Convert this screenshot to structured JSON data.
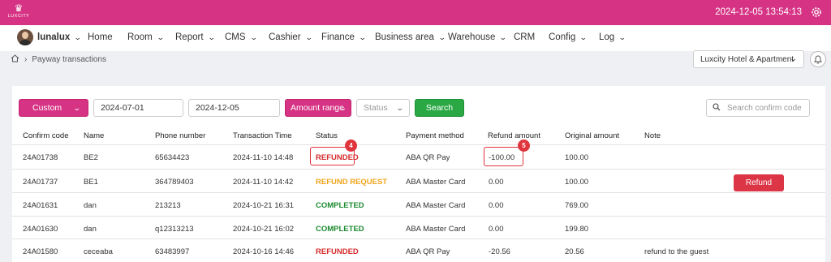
{
  "topbar": {
    "logo_text": "LUXCITY",
    "datetime": "2024-12-05 13:54:13"
  },
  "nav": {
    "user": "lunalux",
    "items": [
      {
        "label": "Home",
        "has_menu": false
      },
      {
        "label": "Room",
        "has_menu": true
      },
      {
        "label": "Report",
        "has_menu": true
      },
      {
        "label": "CMS",
        "has_menu": true
      },
      {
        "label": "Cashier",
        "has_menu": true
      },
      {
        "label": "Finance",
        "has_menu": true
      },
      {
        "label": "Business area",
        "has_menu": true
      },
      {
        "label": "Warehouse",
        "has_menu": true
      },
      {
        "label": "CRM",
        "has_menu": false
      },
      {
        "label": "Config",
        "has_menu": true
      },
      {
        "label": "Log",
        "has_menu": true
      }
    ]
  },
  "breadcrumb": {
    "page": "Payway transactions"
  },
  "hotel_select": {
    "value": "Luxcity Hotel & Apartment"
  },
  "filters": {
    "period": "Custom",
    "date_from": "2024-07-01",
    "date_to": "2024-12-05",
    "amount_range": "Amount range",
    "status_placeholder": "Status",
    "search_button": "Search",
    "search_placeholder": "Search confirm code"
  },
  "table": {
    "columns": [
      "Confirm code",
      "Name",
      "Phone number",
      "Transaction Time",
      "Status",
      "Payment method",
      "Refund amount",
      "Original amount",
      "Note"
    ],
    "rows": [
      {
        "code": "24A01738",
        "name": "BE2",
        "phone": "65634423",
        "time": "2024-11-10 14:48",
        "status": "REFUNDED",
        "method": "ABA QR Pay",
        "refund": "-100.00",
        "original": "100.00",
        "note": ""
      },
      {
        "code": "24A01737",
        "name": "BE1",
        "phone": "364789403",
        "time": "2024-11-10 14:42",
        "status": "REFUND REQUEST",
        "method": "ABA Master Card",
        "refund": "0.00",
        "original": "100.00",
        "note": ""
      },
      {
        "code": "24A01631",
        "name": "dan",
        "phone": "213213",
        "time": "2024-10-21 16:31",
        "status": "COMPLETED",
        "method": "ABA Master Card",
        "refund": "0.00",
        "original": "769.00",
        "note": ""
      },
      {
        "code": "24A01630",
        "name": "dan",
        "phone": "q12313213",
        "time": "2024-10-21 16:02",
        "status": "COMPLETED",
        "method": "ABA Master Card",
        "refund": "0.00",
        "original": "199.80",
        "note": ""
      },
      {
        "code": "24A01580",
        "name": "ceceaba",
        "phone": "63483997",
        "time": "2024-10-16 14:46",
        "status": "REFUNDED",
        "method": "ABA QR Pay",
        "refund": "-20.56",
        "original": "20.56",
        "note": "refund to the guest"
      }
    ],
    "refund_button": "Refund"
  },
  "annotations": {
    "badge_status": "4",
    "badge_refund": "5"
  },
  "colors": {
    "brand": "#d63384",
    "success": "#29a844",
    "danger": "#dc3545",
    "warning": "#f0a41c"
  }
}
